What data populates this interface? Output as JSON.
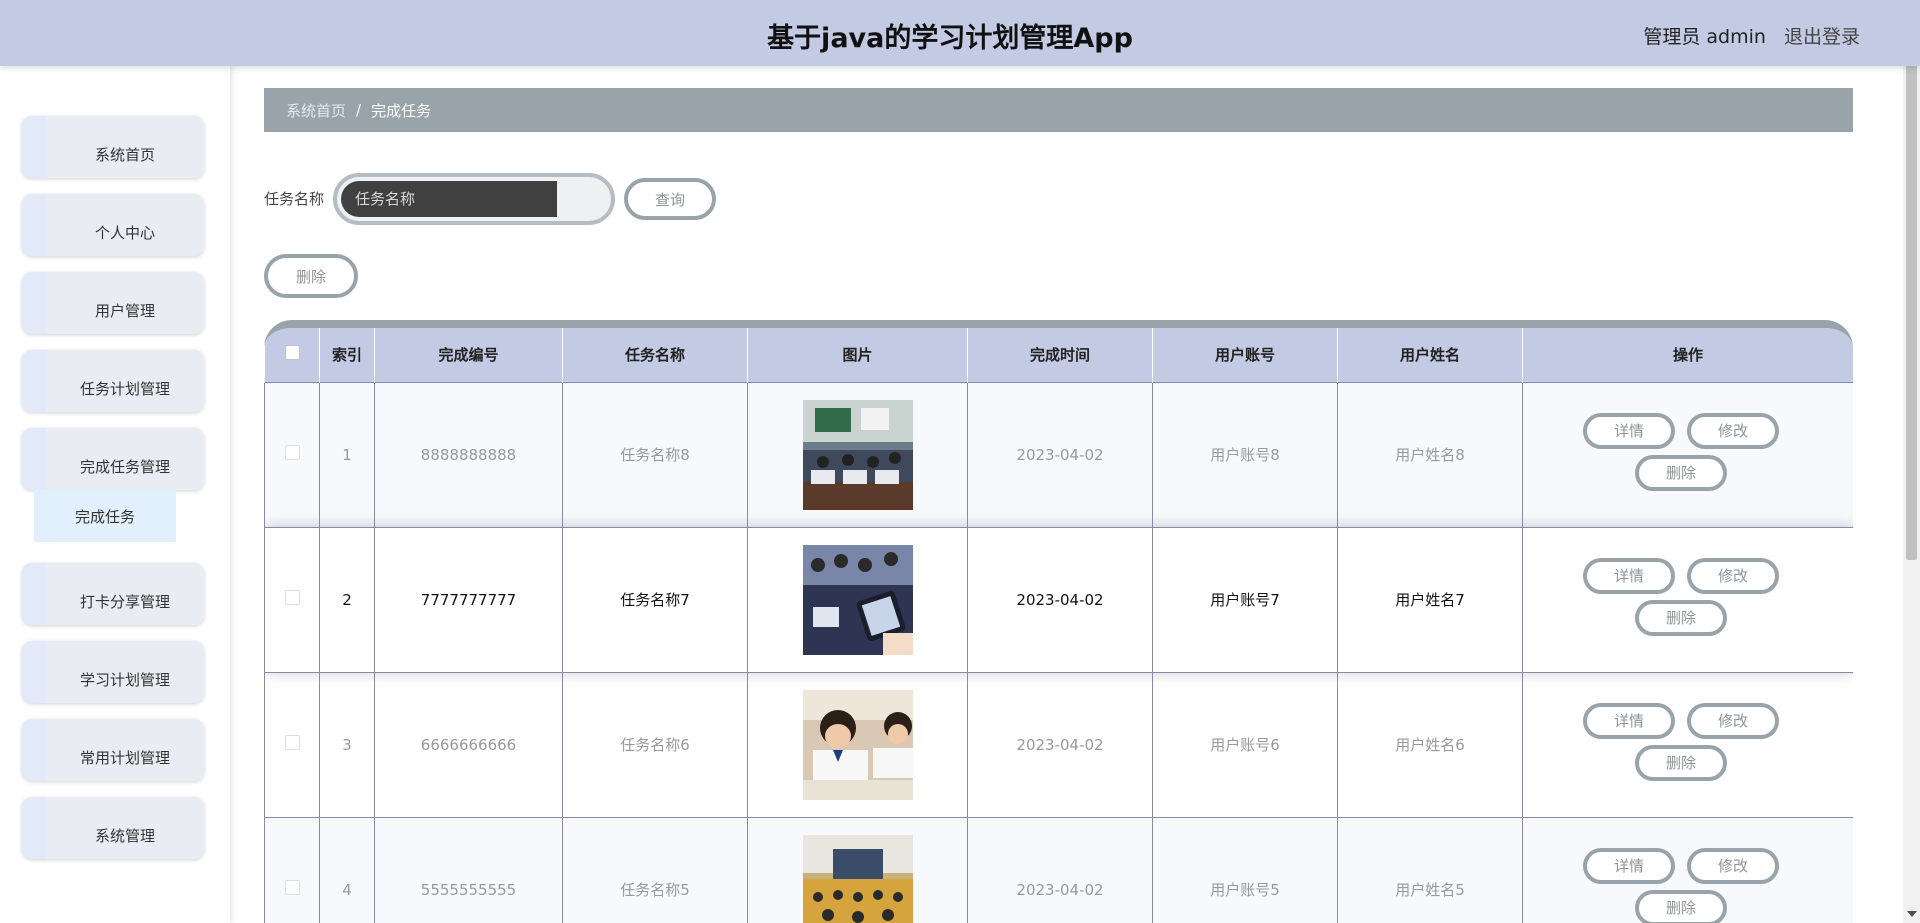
{
  "header": {
    "title": "基于java的学习计划管理App",
    "user_label": "管理员 admin",
    "logout": "退出登录"
  },
  "sidebar": {
    "items": [
      {
        "label": "系统首页"
      },
      {
        "label": "个人中心"
      },
      {
        "label": "用户管理"
      },
      {
        "label": "任务计划管理"
      },
      {
        "label": "完成任务管理"
      },
      {
        "label": "打卡分享管理"
      },
      {
        "label": "学习计划管理"
      },
      {
        "label": "常用计划管理"
      },
      {
        "label": "系统管理"
      }
    ],
    "submenu": {
      "label": "完成任务"
    }
  },
  "breadcrumb": {
    "home": "系统首页",
    "separator": "/",
    "current": "完成任务"
  },
  "search": {
    "label": "任务名称",
    "placeholder": "任务名称",
    "query_button": "查询"
  },
  "toolbar": {
    "delete_button": "删除"
  },
  "table": {
    "headers": [
      "索引",
      "完成编号",
      "任务名称",
      "图片",
      "完成时间",
      "用户账号",
      "用户姓名",
      "操作"
    ],
    "rows": [
      {
        "index": "1",
        "code": "8888888888",
        "task": "任务名称8",
        "image": "classroom-photo",
        "time": "2023-04-02",
        "account": "用户账号8",
        "name": "用户姓名8"
      },
      {
        "index": "2",
        "code": "7777777777",
        "task": "任务名称7",
        "image": "students-tablet-photo",
        "time": "2023-04-02",
        "account": "用户账号7",
        "name": "用户姓名7"
      },
      {
        "index": "3",
        "code": "6666666666",
        "task": "任务名称6",
        "image": "kids-writing-photo",
        "time": "2023-04-02",
        "account": "用户账号6",
        "name": "用户姓名6"
      },
      {
        "index": "4",
        "code": "5555555555",
        "task": "任务名称5",
        "image": "lecture-hall-photo",
        "time": "2023-04-02",
        "account": "用户账号5",
        "name": "用户姓名5"
      }
    ],
    "actions": {
      "detail": "详情",
      "edit": "修改",
      "delete": "删除"
    }
  },
  "colors": {
    "header_bg": "#c2cbe3",
    "breadcrumb_bg": "#98a4aa",
    "button_border": "#98a4aa"
  }
}
